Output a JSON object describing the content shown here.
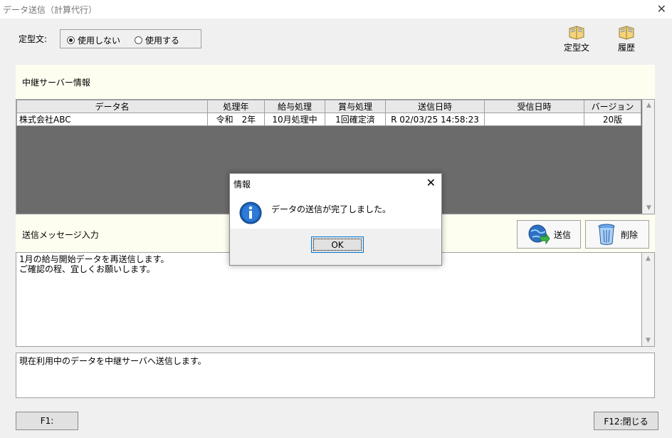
{
  "window": {
    "title": "データ送信（計算代行）",
    "close_glyph": "✕"
  },
  "fixed_text": {
    "label": "定型文:",
    "options": [
      {
        "label": "使用しない",
        "selected": true
      },
      {
        "label": "使用する",
        "selected": false
      }
    ]
  },
  "toolbar": {
    "teikei_label": "定型文",
    "rireki_label": "履歴"
  },
  "relay_panel": {
    "label": "中継サーバー情報"
  },
  "grid": {
    "columns": [
      "データ名",
      "処理年",
      "給与処理",
      "賞与処理",
      "送信日時",
      "受信日時",
      "バージョン"
    ],
    "rows": [
      [
        "株式会社ABC",
        "令和　2年",
        "10月処理中",
        "1回確定済",
        "R 02/03/25 14:58:23",
        "",
        "20版"
      ]
    ]
  },
  "message_panel": {
    "label": "送信メッセージ入力"
  },
  "buttons": {
    "send_label": "送信",
    "delete_label": "削除"
  },
  "message_text": "1月の給与開始データを再送信します。\nご確認の程、宜しくお願いします。",
  "status_text": "現在利用中のデータを中継サーバへ送信します。",
  "function_keys": {
    "f1_label": "F1:",
    "f12_label": "F12:閉じる"
  },
  "dialog": {
    "title": "情報",
    "close_glyph": "✕",
    "message": "データの送信が完了しました。",
    "ok_label": "OK",
    "icon": "info-icon"
  },
  "colors": {
    "grid_background": "#6b6b6b",
    "panel_background": "#fefef0",
    "info_blue": "#1a5fb4"
  }
}
